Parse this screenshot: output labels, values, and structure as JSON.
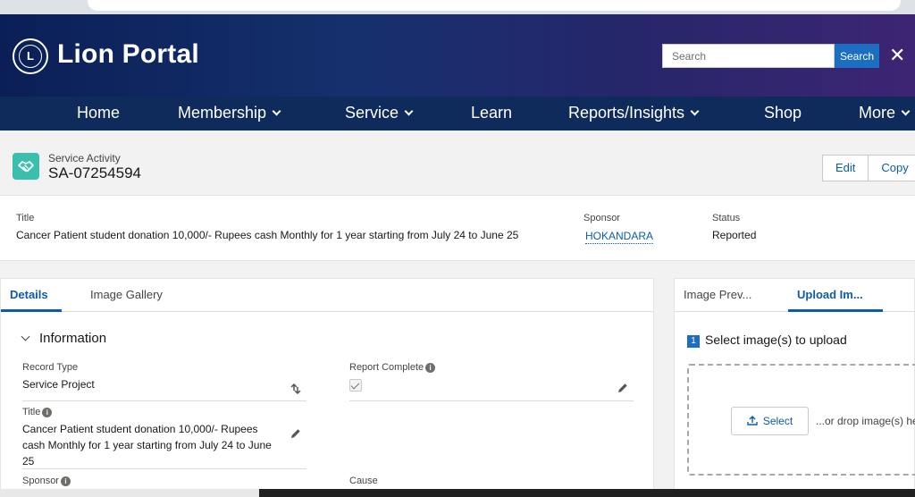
{
  "header": {
    "brand": "Lion Portal",
    "logo_letter": "L",
    "search_placeholder": "Search",
    "search_button": "Search",
    "close_glyph": "✕"
  },
  "nav": {
    "items": [
      {
        "label": "Home",
        "has_dropdown": false
      },
      {
        "label": "Membership",
        "has_dropdown": true
      },
      {
        "label": "Service",
        "has_dropdown": true
      },
      {
        "label": "Learn",
        "has_dropdown": false
      },
      {
        "label": "Reports/Insights",
        "has_dropdown": true
      },
      {
        "label": "Shop",
        "has_dropdown": false
      },
      {
        "label": "More",
        "has_dropdown": true
      }
    ]
  },
  "record": {
    "type": "Service Activity",
    "id": "SA-07254594",
    "icon": "handshake-icon",
    "buttons": {
      "edit": "Edit",
      "copy": "Copy"
    }
  },
  "highlights": {
    "title_label": "Title",
    "title_value": "Cancer Patient student donation 10,000/- Rupees cash Monthly for 1 year starting from July 24 to June 25",
    "sponsor_label": "Sponsor",
    "sponsor_value": "HOKANDARA",
    "status_label": "Status",
    "status_value": "Reported"
  },
  "details": {
    "tabs": [
      "Details",
      "Image Gallery"
    ],
    "section": "Information",
    "record_type_label": "Record Type",
    "record_type_value": "Service Project",
    "report_complete_label": "Report Complete",
    "report_complete_checked": true,
    "title_label": "Title",
    "title_value": "Cancer Patient student donation 10,000/- Rupees cash Monthly for 1 year starting from July 24 to June 25",
    "sponsor_label": "Sponsor",
    "cause_label": "Cause",
    "info_glyph": "i"
  },
  "side": {
    "tabs": [
      "Image Prev...",
      "Upload Im..."
    ],
    "step_number": "1",
    "step_title": "Select image(s) to upload",
    "select_button": "Select",
    "drop_text": "...or drop image(s) he"
  },
  "colors": {
    "accent": "#0b5cab",
    "nav_bg": "#0e2b5c",
    "icon_teal": "#3bbfad"
  }
}
